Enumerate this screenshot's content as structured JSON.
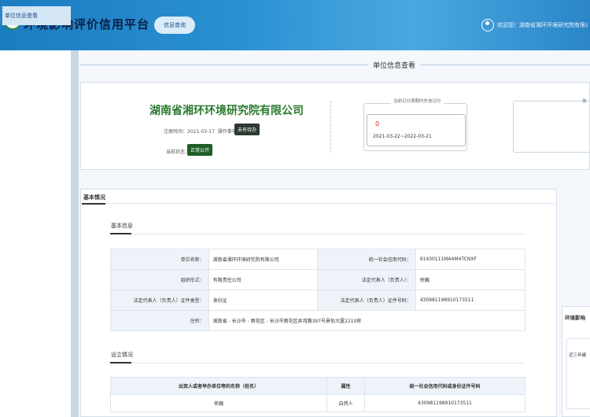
{
  "header": {
    "site_title": "环境影响评价信用平台",
    "nav_pill": "信息查询",
    "welcome": "欢迎您！湖南省湘环环境研究院有限公司"
  },
  "sidebar": {
    "items": [
      {
        "label": "单位信息查看",
        "active": true
      }
    ]
  },
  "page": {
    "title": "单位信息查看"
  },
  "company": {
    "name": "湖南省湘环环境研究院有限公司",
    "reg_time_label": "注册时间：",
    "reg_time": "2021-03-17",
    "matter_label": "操作事项：",
    "matter_badge": "未有待办",
    "status_label": "当前状态：",
    "status_badge": "正常公开"
  },
  "score_card": {
    "caption": "当前记分周期内失信记分",
    "value": "0",
    "period": "2021-03-22~2022-03-21"
  },
  "card3": {
    "caption": "信"
  },
  "basic": {
    "tag": "基本情况",
    "section_basic_title": "基本信息",
    "rows": [
      [
        {
          "label": "单位名称：",
          "value": "湖南省湘环环境研究院有限公司"
        },
        {
          "label": "统一社会信用代码：",
          "value": "91430111MA4M4TCNXF"
        }
      ],
      [
        {
          "label": "组织形式：",
          "value": "有限责任公司"
        },
        {
          "label": "法定代表人（负责人）：",
          "value": "徐巍"
        }
      ],
      [
        {
          "label": "法定代表人（负责人）证件类型：",
          "value": "身份证"
        },
        {
          "label": "法定代表人（负责人）证件号码：",
          "value": "430981198910173511"
        }
      ]
    ],
    "address_label": "住所：",
    "address": "湖南省 - 长沙市 - 雨花区 - 长沙市雨花区井湾路397号景怡大厦2210房",
    "section_setup_title": "设立情况",
    "setup_headers": [
      "出资人或者举办单位等的名称（姓名）",
      "属性",
      "统一社会信用代码或身份证件号码"
    ],
    "setup_rows": [
      [
        "徐巍",
        "自然人",
        "430981198910173511"
      ]
    ]
  },
  "right_card": {
    "title": "环境影响",
    "sub": "近三年编"
  },
  "colors": {
    "header_blue": "#2a90d2",
    "company_green": "#2a7a30",
    "score_red": "#e02020",
    "badge_dark": "#2d3a32",
    "badge_green": "#1f5e26"
  },
  "icons": {
    "logo": "platform-logo-icon",
    "user": "user-icon"
  }
}
